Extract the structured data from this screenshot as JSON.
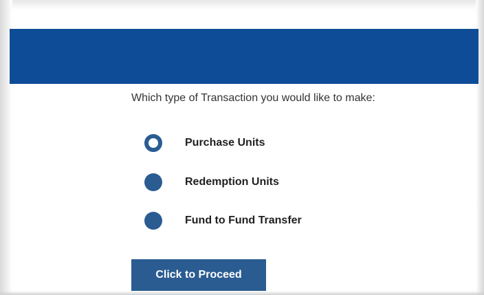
{
  "form": {
    "question": "Which type of Transaction you would like to make:",
    "options": [
      {
        "label": "Purchase Units",
        "selected": true
      },
      {
        "label": "Redemption Units",
        "selected": false
      },
      {
        "label": "Fund to Fund Transfer",
        "selected": false
      }
    ],
    "proceed_label": "Click to Proceed"
  },
  "colors": {
    "header": "#0f4c97",
    "accent": "#2a5c92"
  }
}
